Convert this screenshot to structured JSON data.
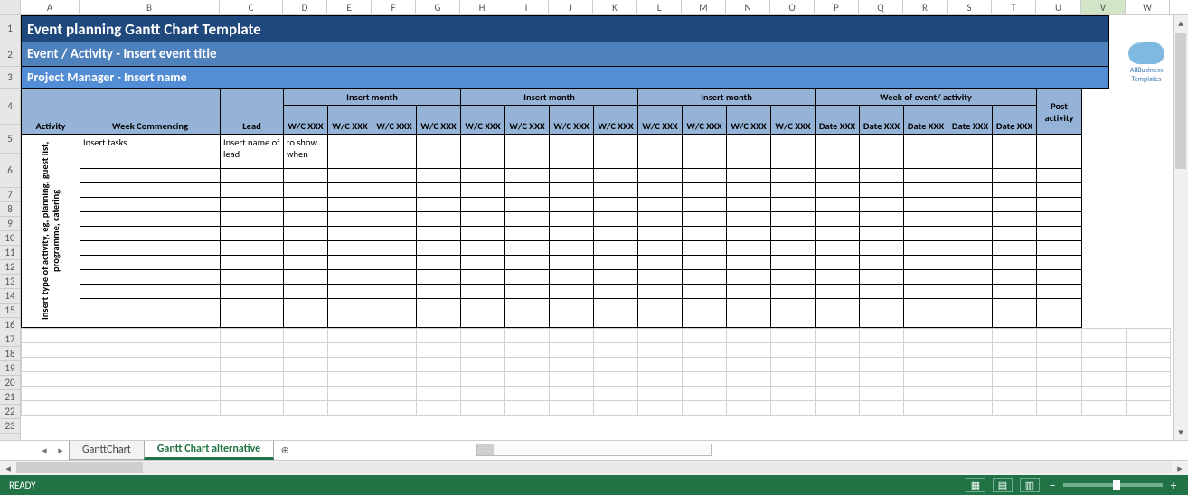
{
  "columns": [
    {
      "letter": "A",
      "w": 65
    },
    {
      "letter": "B",
      "w": 155
    },
    {
      "letter": "C",
      "w": 70
    },
    {
      "letter": "D",
      "w": 49
    },
    {
      "letter": "E",
      "w": 49
    },
    {
      "letter": "F",
      "w": 49
    },
    {
      "letter": "G",
      "w": 49
    },
    {
      "letter": "H",
      "w": 49
    },
    {
      "letter": "I",
      "w": 49
    },
    {
      "letter": "J",
      "w": 49
    },
    {
      "letter": "K",
      "w": 49
    },
    {
      "letter": "L",
      "w": 49
    },
    {
      "letter": "M",
      "w": 49
    },
    {
      "letter": "N",
      "w": 49
    },
    {
      "letter": "O",
      "w": 49
    },
    {
      "letter": "P",
      "w": 49
    },
    {
      "letter": "Q",
      "w": 49
    },
    {
      "letter": "R",
      "w": 49
    },
    {
      "letter": "S",
      "w": 49
    },
    {
      "letter": "T",
      "w": 49
    },
    {
      "letter": "U",
      "w": 50
    },
    {
      "letter": "V",
      "w": 49
    },
    {
      "letter": "W",
      "w": 49
    }
  ],
  "selected_col": "V",
  "rows": {
    "r1": 30,
    "r2": 27,
    "r3": 24,
    "r4": 40,
    "r5": 32,
    "r6": 38,
    "r7": 16,
    "r8": 16,
    "r9": 16,
    "r10": 16,
    "r11": 16,
    "r12": 16,
    "r13": 16,
    "r14": 16,
    "r15": 16,
    "r16": 16,
    "r17": 16,
    "r18": 16,
    "r19": 16,
    "r20": 16,
    "r21": 16,
    "r22": 16,
    "r23": 16
  },
  "titles": {
    "main": "Event planning Gantt Chart Template",
    "sub1": "Event / Activity - Insert event title",
    "sub2": "Project Manager -  Insert name"
  },
  "headers": {
    "activity": "Activity",
    "week_commencing": "Week Commencing",
    "lead": "Lead",
    "month_groups": [
      "Insert month",
      "Insert month",
      "Insert month"
    ],
    "week_of_event": "Week of event/ activity",
    "post_activity": "Post activity",
    "wc": [
      "W/C XXX",
      "W/C XXX",
      "W/C XXX",
      "W/C XXX",
      "W/C XXX",
      "W/C XXX",
      "W/C XXX",
      "W/C XXX",
      "W/C XXX",
      "W/C XXX",
      "W/C XXX",
      "W/C XXX"
    ],
    "dates": [
      "Date XXX",
      "Date XXX",
      "Date XXX",
      "Date XXX",
      "Date XXX"
    ]
  },
  "body": {
    "activity_rot": "Insert type of activity, eg, planning, guest list, programme, catering",
    "tasks_hint": "Insert tasks",
    "lead_hint": "Insert name of lead",
    "show_hint": "to show when"
  },
  "logo_text": "AllBusiness Templates",
  "tabs": {
    "items": [
      "GanttChart",
      "Gantt Chart alternative"
    ],
    "active": 1,
    "add": "⊕"
  },
  "status": {
    "ready": "READY",
    "zoom": "100%"
  },
  "icons": {
    "tri_l": "◂",
    "tri_r": "▸",
    "tri_u": "▴",
    "tri_d": "▾",
    "minus": "−",
    "plus": "+"
  }
}
